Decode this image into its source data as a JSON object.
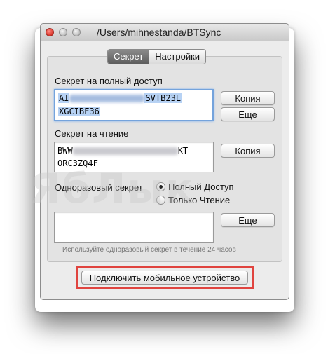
{
  "window": {
    "title": "/Users/mihnestanda/BTSync"
  },
  "tabs": [
    {
      "label": "Секрет",
      "active": true
    },
    {
      "label": "Настройки",
      "active": false
    }
  ],
  "full_access": {
    "label": "Секрет на полный доступ",
    "value_start": "AI",
    "value_end": "SVTB23L",
    "value_line2": "XGCIBF36",
    "copy_label": "Копия",
    "more_label": "Еще"
  },
  "read_only": {
    "label": "Секрет на чтение",
    "value_start": "BWW",
    "value_end": "KT",
    "value_line2": "ORC3ZQ4F",
    "copy_label": "Копия"
  },
  "one_time": {
    "label": "Одноразовый секрет",
    "options": [
      {
        "label": "Полный Доступ",
        "selected": true
      },
      {
        "label": "Только Чтение",
        "selected": false
      }
    ],
    "value": "",
    "more_label": "Еще",
    "hint": "Используйте одноразовый секрет в течение 24 часов"
  },
  "connect_label": "Подключить мобильное устройство",
  "watermark": "ЯбЛык",
  "colors": {
    "highlight": "#e0443f",
    "focus": "#74a3dc",
    "selection": "#b7d2f4"
  }
}
